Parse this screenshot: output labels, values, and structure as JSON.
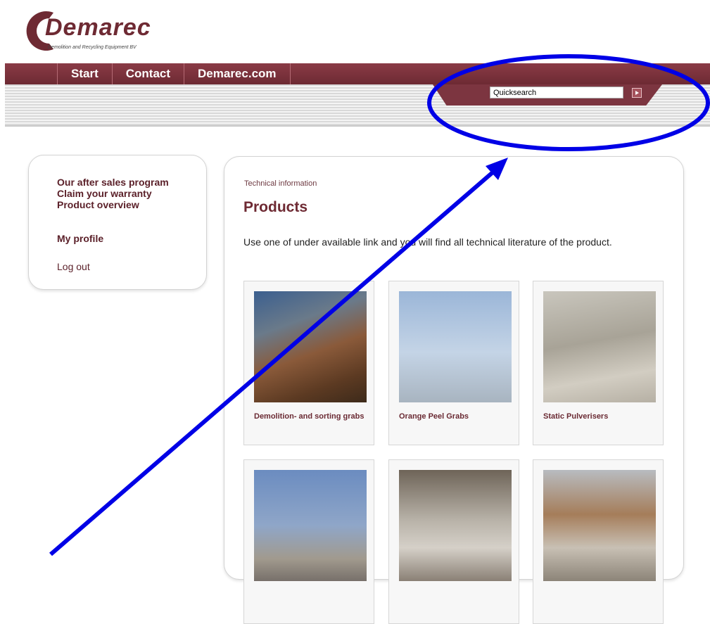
{
  "logo": {
    "name": "Demarec",
    "tagline": "Demolition and Recycling Equipment BV"
  },
  "nav": {
    "items": [
      {
        "label": "Start"
      },
      {
        "label": "Contact"
      },
      {
        "label": "Demarec.com"
      }
    ]
  },
  "search": {
    "value": "Quicksearch"
  },
  "sidebar": {
    "links": [
      {
        "label": "Our after sales program"
      },
      {
        "label": "Claim your warranty"
      },
      {
        "label": "Product overview"
      },
      {
        "label": "My profile"
      },
      {
        "label": "Log out"
      }
    ]
  },
  "main": {
    "breadcrumb": "Technical information",
    "title": "Products",
    "intro": "Use one of under available link and you will find all technical literature of the product.",
    "products": [
      {
        "label": "Demolition- and sorting grabs"
      },
      {
        "label": "Orange Peel Grabs"
      },
      {
        "label": "Static Pulverisers"
      },
      {
        "label": ""
      },
      {
        "label": ""
      },
      {
        "label": ""
      }
    ]
  },
  "annotation": {
    "color": "#0000e6"
  }
}
